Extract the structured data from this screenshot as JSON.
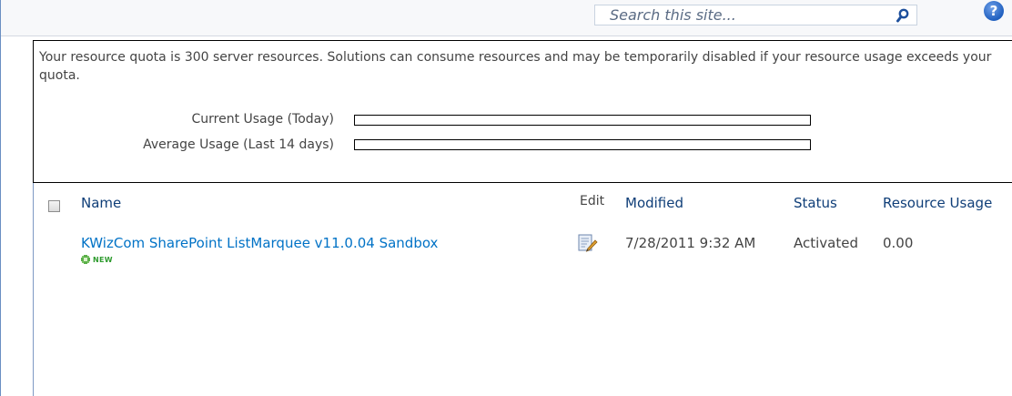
{
  "search": {
    "placeholder": "Search this site..."
  },
  "quota": {
    "message": "Your resource quota is 300 server resources. Solutions can consume resources and may be temporarily disabled if your resource usage exceeds your quota.",
    "current_label": "Current Usage (Today)",
    "average_label": "Average Usage (Last 14 days)",
    "current_fill": 0,
    "average_fill": 0
  },
  "table": {
    "columns": {
      "name": "Name",
      "edit": "Edit",
      "modified": "Modified",
      "status": "Status",
      "resource_usage": "Resource Usage"
    },
    "rows": [
      {
        "name": "KWizCom SharePoint ListMarquee v11.0.04 Sandbox",
        "badge": "NEW",
        "modified": "7/28/2011 9:32 AM",
        "status": "Activated",
        "resource_usage": "0.00"
      }
    ]
  },
  "icons": {
    "search": "search-icon",
    "help": "help-icon",
    "edit": "edit-icon",
    "new": "new-star-icon"
  },
  "colors": {
    "link": "#0072c6",
    "header": "#0f3e78",
    "new_badge": "#2f9b2f",
    "help": "#1f5fbf"
  }
}
